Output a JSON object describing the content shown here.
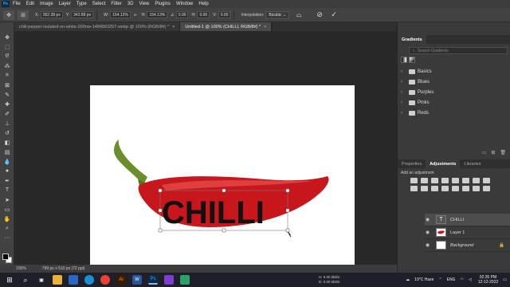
{
  "menu": [
    "File",
    "Edit",
    "Image",
    "Layer",
    "Type",
    "Select",
    "Filter",
    "3D",
    "View",
    "Plugins",
    "Window",
    "Help"
  ],
  "app_logo": "Ps",
  "options": {
    "x_label": "X:",
    "x_value": "362.38 px",
    "y_label": "Y:",
    "y_value": "342.89 px",
    "w_label": "W:",
    "w_value": "154.13%",
    "h_label": "H:",
    "h_value": "154.13%",
    "angle_value": "0.00",
    "hskew_label": "H:",
    "hskew_value": "0.00",
    "vskew_label": "V:",
    "vskew_value": "0.00",
    "interp_label": "Interpolation:",
    "interp_value": "Bicubic"
  },
  "tabs": [
    {
      "label": "chili-pepper-isolated-on-white-260nw-1484563257.webp @ 100% (RGB/8#) *",
      "active": false
    },
    {
      "label": "Untitled-1 @ 100% (CHILLI, RGB/8#) *",
      "active": true
    }
  ],
  "canvas": {
    "text": "CHILLI",
    "colors": {
      "pepper": "#c8171c",
      "stem": "#5f8a2a",
      "text": "#111111"
    }
  },
  "status": {
    "zoom": "100%",
    "doc_size": "799 px x 510 px (72 ppi)"
  },
  "panels": {
    "gradients_tab": "Gradients",
    "search_placeholder": "Search Gradients",
    "folders": [
      "Basics",
      "Blues",
      "Purples",
      "Pinks",
      "Reds"
    ],
    "properties_tab": "Properties",
    "adjustments_tab": "Adjustments",
    "libraries_tab": "Libraries",
    "add_adjustment": "Add an adjustment"
  },
  "layers": [
    {
      "name": "CHILLI",
      "type": "text",
      "selected": true
    },
    {
      "name": "Layer 1",
      "type": "image",
      "selected": false
    },
    {
      "name": "Background",
      "type": "background",
      "selected": false
    }
  ],
  "taskbar": {
    "weather": "19°C Haze",
    "lang": "ENG",
    "time": "02:35 PM",
    "date": "12-12-2022",
    "net_up_label": "U:",
    "net_up": "0.00 kbit/s",
    "net_down_label": "D:",
    "net_down": "0.00 kbit/s"
  }
}
